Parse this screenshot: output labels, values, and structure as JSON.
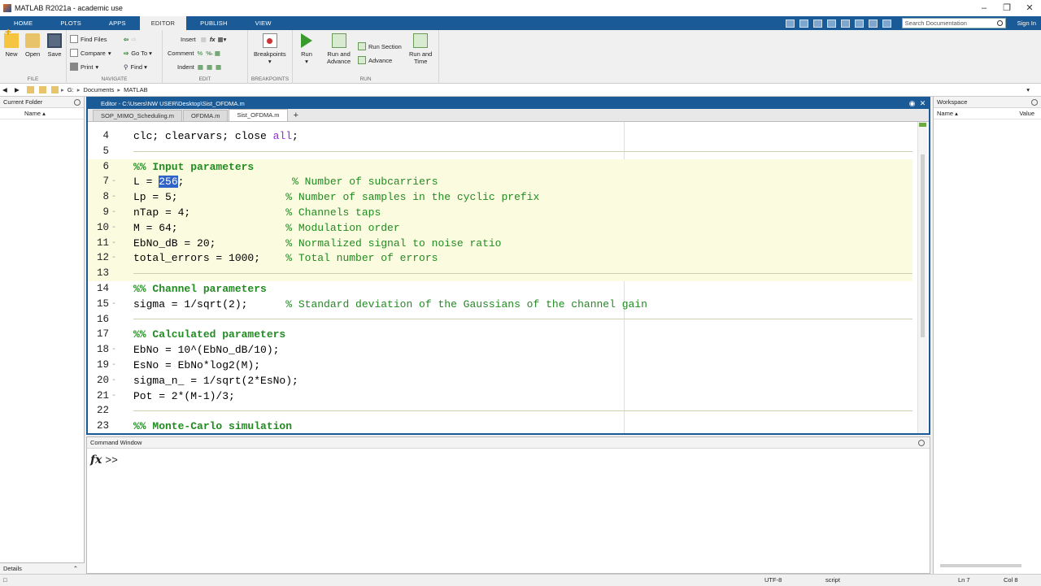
{
  "window": {
    "title": "MATLAB R2021a - academic use",
    "controls": [
      "minimize-icon",
      "restore-icon",
      "close-icon"
    ]
  },
  "ribbon_tabs": [
    {
      "label": "HOME",
      "active": false
    },
    {
      "label": "PLOTS",
      "active": false
    },
    {
      "label": "APPS",
      "active": false
    },
    {
      "label": "EDITOR",
      "active": true
    },
    {
      "label": "PUBLISH",
      "active": false
    },
    {
      "label": "VIEW",
      "active": false
    }
  ],
  "search": {
    "placeholder": "Search Documentation"
  },
  "signin_label": "Sign In",
  "toolstrip": {
    "file": {
      "label": "FILE",
      "new": "New",
      "open": "Open",
      "save": "Save"
    },
    "navigate": {
      "label": "NAVIGATE",
      "find_files": "Find Files",
      "compare": "Compare",
      "print": "Print",
      "go_to": "Go To",
      "find": "Find"
    },
    "edit": {
      "label": "EDIT",
      "insert": "Insert",
      "comment": "Comment",
      "indent": "Indent"
    },
    "breakpoints": {
      "label": "BREAKPOINTS",
      "button": "Breakpoints"
    },
    "run": {
      "label": "RUN",
      "run": "Run",
      "run_and_advance_1": "Run and",
      "run_and_advance_2": "Advance",
      "run_section": "Run Section",
      "advance": "Advance",
      "run_and_time_1": "Run and",
      "run_and_time_2": "Time"
    }
  },
  "address": {
    "crumbs": [
      "G:",
      "Documents",
      "MATLAB"
    ]
  },
  "current_folder": {
    "title": "Current Folder",
    "column": "Name ▴",
    "details": "Details"
  },
  "editor": {
    "title": "Editor - C:\\Users\\NW USER\\Desktop\\Sist_OFDMA.m",
    "tabs": [
      {
        "label": "SOP_MIMO_Scheduling.m",
        "active": false
      },
      {
        "label": "OFDMA.m",
        "active": false
      },
      {
        "label": "Sist_OFDMA.m",
        "active": true
      }
    ],
    "add_tab": "+",
    "lines": [
      {
        "n": "4",
        "dash": "",
        "code": "clc; clearvars; close ",
        "str": "all",
        "after": ";",
        "cell": false
      },
      {
        "n": "5",
        "dash": "",
        "code": "",
        "cell": false
      },
      {
        "n": "6",
        "dash": "",
        "header": "%% Input parameters",
        "cell": true
      },
      {
        "n": "7",
        "dash": "-",
        "pre": "L = ",
        "sel": "256",
        "post": ";",
        "pad": "                 ",
        "comment": "% Number of subcarriers",
        "cell": true
      },
      {
        "n": "8",
        "dash": "-",
        "code": "Lp = 5;                 ",
        "comment": "% Number of samples in the cyclic prefix",
        "cell": true
      },
      {
        "n": "9",
        "dash": "-",
        "code": "nTap = 4;               ",
        "comment": "% Channels taps",
        "cell": true
      },
      {
        "n": "10",
        "dash": "-",
        "code": "M = 64;                 ",
        "comment": "% Modulation order",
        "cell": true
      },
      {
        "n": "11",
        "dash": "-",
        "code": "EbNo_dB = 20;           ",
        "comment": "% Normalized signal to noise ratio",
        "cell": true
      },
      {
        "n": "12",
        "dash": "-",
        "code": "total_errors = 1000;    ",
        "comment": "% Total number of errors",
        "cell": true
      },
      {
        "n": "13",
        "dash": "",
        "code": "",
        "cell": true
      },
      {
        "n": "14",
        "dash": "",
        "header": "%% Channel parameters",
        "cell": false
      },
      {
        "n": "15",
        "dash": "-",
        "code": "sigma = 1/sqrt(2);      ",
        "comment": "% Standard deviation of the Gaussians of the channel gain",
        "cell": false
      },
      {
        "n": "16",
        "dash": "",
        "code": "",
        "cell": false
      },
      {
        "n": "17",
        "dash": "",
        "header": "%% Calculated parameters",
        "cell": false
      },
      {
        "n": "18",
        "dash": "-",
        "code": "EbNo = 10^(EbNo_dB/10);",
        "cell": false
      },
      {
        "n": "19",
        "dash": "-",
        "code": "EsNo = EbNo*log2(M);",
        "cell": false
      },
      {
        "n": "20",
        "dash": "-",
        "code": "sigma_n_ = 1/sqrt(2*EsNo);",
        "cell": false
      },
      {
        "n": "21",
        "dash": "-",
        "code": "Pot = 2*(M-1)/3;",
        "cell": false
      },
      {
        "n": "22",
        "dash": "",
        "code": "",
        "cell": false
      },
      {
        "n": "23",
        "dash": "",
        "header": "%% Monte-Carlo simulation",
        "cell": false
      }
    ]
  },
  "command_window": {
    "title": "Command Window",
    "fx": "fx",
    "prompt": ">>"
  },
  "workspace": {
    "title": "Workspace",
    "col_name": "Name ▴",
    "col_value": "Value"
  },
  "status": {
    "encoding": "UTF-8",
    "type": "script",
    "ln": "Ln  7",
    "col": "Col  8"
  },
  "colors": {
    "ribbon": "#1a5a96",
    "cell_bg": "#fbfbe0",
    "comment": "#228b22",
    "string": "#a020f0",
    "selection": "#2f63c7"
  }
}
